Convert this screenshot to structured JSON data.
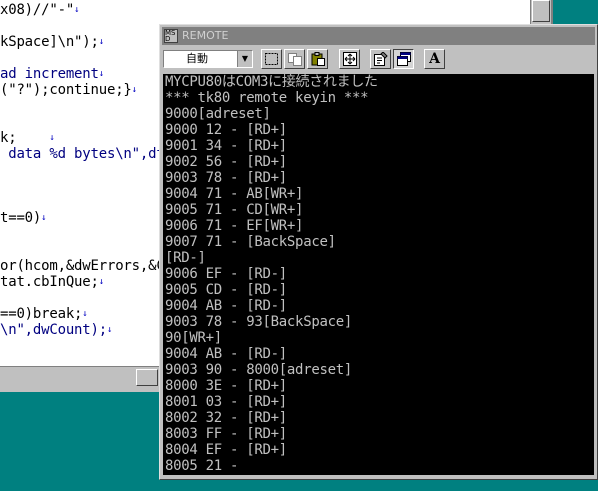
{
  "editor": {
    "lines": [
      {
        "text": "x08)//\"-\"",
        "marker": "↓",
        "style": "blk"
      },
      {
        "text": "",
        "marker": "",
        "style": "blk"
      },
      {
        "text": "kSpace]\\n\");",
        "marker": "↓",
        "style": "blk"
      },
      {
        "text": "",
        "marker": "",
        "style": "blk"
      },
      {
        "text": "ad increment",
        "marker": "↓",
        "style": "cont"
      },
      {
        "text": "(\"?\");continue;}",
        "marker": "↓",
        "style": "blk"
      },
      {
        "text": "",
        "marker": "",
        "style": "blk"
      },
      {
        "text": "",
        "marker": "",
        "style": "blk"
      },
      {
        "text": "k;    ",
        "marker": "↓",
        "style": "blk"
      },
      {
        "text": " data %d bytes\\n\",dt",
        "marker": "",
        "style": "cont"
      },
      {
        "text": "",
        "marker": "",
        "style": "blk"
      },
      {
        "text": "",
        "marker": "",
        "style": "blk"
      },
      {
        "text": "",
        "marker": "",
        "style": "blk"
      },
      {
        "text": "t==0)",
        "marker": "↓",
        "style": "blk"
      },
      {
        "text": "",
        "marker": "",
        "style": "blk"
      },
      {
        "text": "",
        "marker": "",
        "style": "blk"
      },
      {
        "text": "or(hcom,&dwErrors,&C",
        "marker": "",
        "style": "blk"
      },
      {
        "text": "tat.cbInQue;",
        "marker": "↓",
        "style": "blk"
      },
      {
        "text": "",
        "marker": "",
        "style": "blk"
      },
      {
        "text": "==0)break;",
        "marker": "↓",
        "style": "blk"
      },
      {
        "text": "\\n\",dwCount);",
        "marker": "↓",
        "style": "cont"
      }
    ]
  },
  "remote": {
    "title": "REMOTE",
    "zoom_value": "自動",
    "toolbar_font_label": "A",
    "console_lines": [
      "MYCPU80はCOM3に接続されました",
      "*** tk80 remote keyin ***",
      "9000[adreset]",
      "9000 12 - [RD+]",
      "9001 34 - [RD+]",
      "9002 56 - [RD+]",
      "9003 78 - [RD+]",
      "9004 71 - AB[WR+]",
      "9005 71 - CD[WR+]",
      "9006 71 - EF[WR+]",
      "9007 71 - [BackSpace]",
      "[RD-]",
      "9006 EF - [RD-]",
      "9005 CD - [RD-]",
      "9004 AB - [RD-]",
      "9003 78 - 93[BackSpace]",
      "90[WR+]",
      "9004 AB - [RD-]",
      "9003 90 - 8000[adreset]",
      "8000 3E - [RD+]",
      "8001 03 - [RD+]",
      "8002 32 - [RD+]",
      "8003 FF - [RD+]",
      "8004 EF - [RD+]",
      "8005 21 -"
    ]
  }
}
